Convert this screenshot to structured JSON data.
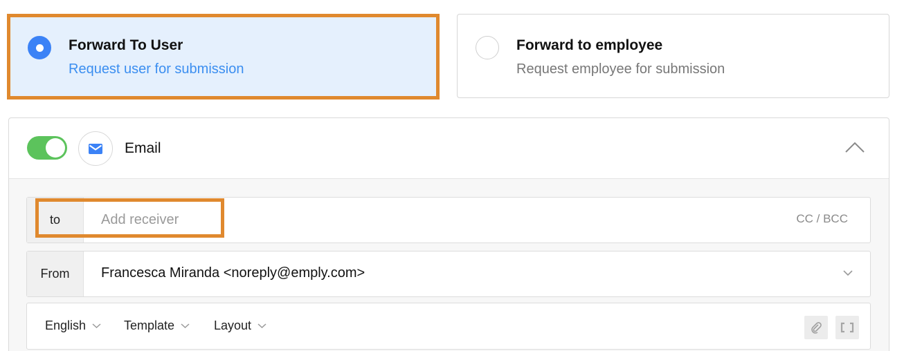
{
  "options": [
    {
      "title": "Forward To User",
      "subtitle": "Request user for submission",
      "selected": true
    },
    {
      "title": "Forward to employee",
      "subtitle": "Request employee for submission",
      "selected": false
    }
  ],
  "email": {
    "label": "Email",
    "toggle_on": true,
    "to_label": "to",
    "receiver_placeholder": "Add receiver",
    "cc_bcc": "CC / BCC",
    "from_label": "From",
    "from_value": "Francesca Miranda <noreply@emply.com>",
    "toolbar": {
      "language": "English",
      "template": "Template",
      "layout": "Layout"
    }
  },
  "colors": {
    "accent": "#3b82f6",
    "highlight": "#e0892e",
    "toggle": "#5cc35c",
    "selected_bg": "#e5f0fd"
  },
  "icons": {
    "mail": "envelope-icon",
    "collapse": "chevron-up-icon",
    "dropdown": "chevron-down-icon",
    "attach": "paperclip-icon",
    "brackets": "brackets-icon"
  }
}
